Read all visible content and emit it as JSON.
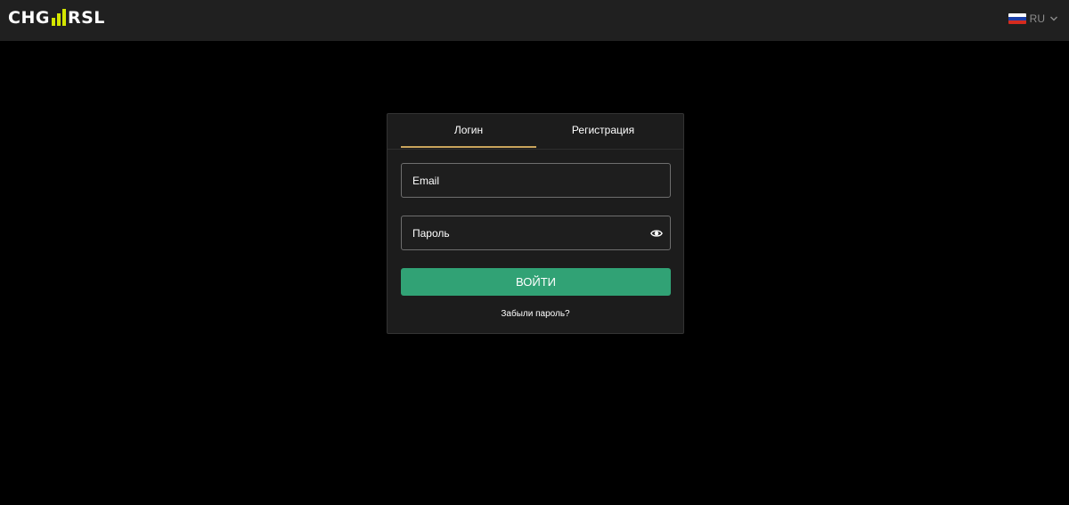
{
  "header": {
    "logo": {
      "left_text": "CHG",
      "right_text": "RSL",
      "accent_color": "#d4e600"
    },
    "language": {
      "code": "RU",
      "flag_icon": "russia-flag-icon"
    }
  },
  "auth": {
    "tabs": [
      {
        "label": "Логин",
        "active": true
      },
      {
        "label": "Регистрация",
        "active": false
      }
    ],
    "email_placeholder": "Email",
    "password_placeholder": "Пароль",
    "submit_label": "ВОЙТИ",
    "forgot_label": "Забыли пароль?"
  },
  "colors": {
    "background": "#000000",
    "header": "#202020",
    "card": "#1c1c1c",
    "primary": "#31a275",
    "tab_underline": "#c9a45c"
  }
}
